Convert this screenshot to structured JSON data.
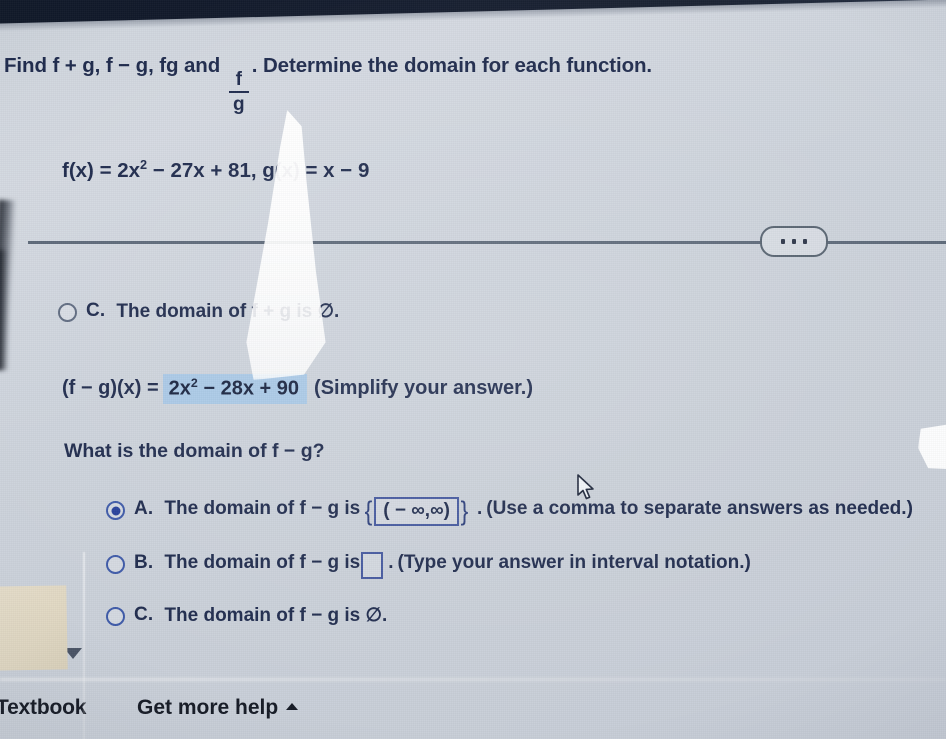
{
  "problem": {
    "prompt_prefix": "Find f + g, f − g, fg and",
    "fraction_numerator": "f",
    "fraction_denominator": "g",
    "prompt_suffix": ". Determine the domain for each function.",
    "functions_text": "f(x) = 2x",
    "functions_exponent": "2",
    "functions_text2": " − 27x + 81, g(x) = x − 9"
  },
  "toolbar": {
    "more_options_label": "more-options"
  },
  "previous_part": {
    "option_letter": "C.",
    "option_text": "The domain of f + g is ∅.",
    "selected": false
  },
  "answer_line": {
    "label": "(f − g)(x) =",
    "value_prefix": "2x",
    "value_exponent": "2",
    "value_suffix": " − 28x + 90",
    "hint": "(Simplify your answer.)"
  },
  "question": {
    "text": "What is the domain of f − g?"
  },
  "options": [
    {
      "letter": "A.",
      "text_before": "The domain of f − g is",
      "brace_open": "{",
      "field_value": "( − ∞,∞)",
      "brace_close": "}",
      "text_after": ".",
      "hint": "(Use a comma to separate answers as needed.)",
      "selected": true
    },
    {
      "letter": "B.",
      "text_before": "The domain of f − g is",
      "field_value": "",
      "text_after": ".",
      "hint": "(Type your answer in interval notation.)",
      "selected": false
    },
    {
      "letter": "C.",
      "text_before": "The domain of f − g is ∅.",
      "hint": "",
      "selected": false
    }
  ],
  "footer": {
    "textbook_label": "Textbook",
    "help_label": "Get more help"
  },
  "colors": {
    "accent_blue": "#27409b",
    "highlight": "#a9c8e6",
    "text": "#1f2b4d",
    "divider": "#5c6878"
  }
}
